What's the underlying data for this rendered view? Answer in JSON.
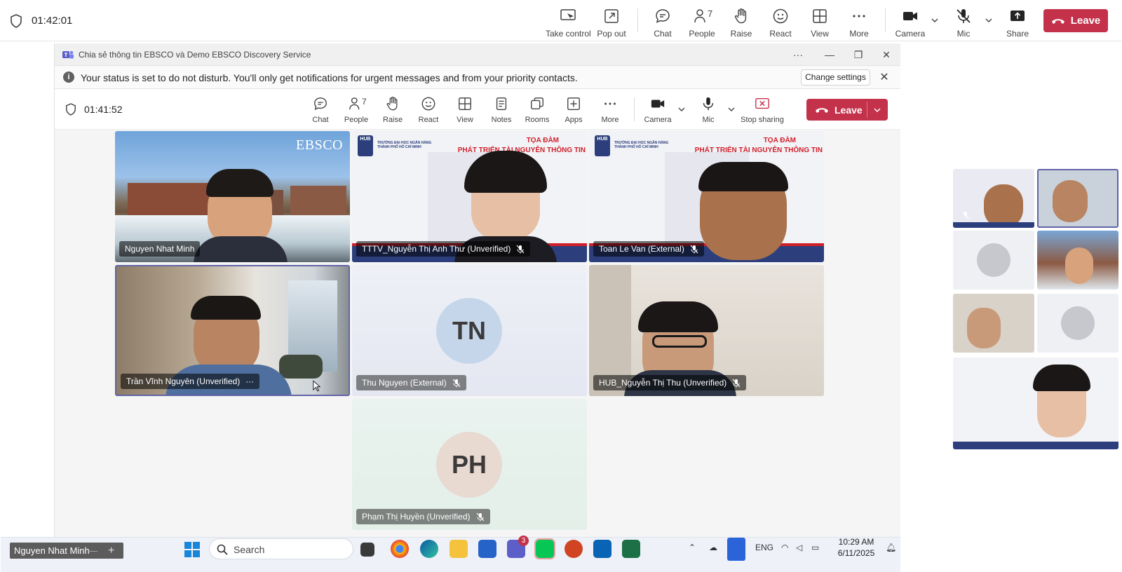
{
  "topbar": {
    "timer": "01:42:01",
    "buttons": {
      "take_control": "Take control",
      "pop_out": "Pop out",
      "chat": "Chat",
      "people": "People",
      "people_count": "7",
      "raise": "Raise",
      "react": "React",
      "view": "View",
      "more": "More",
      "camera": "Camera",
      "mic": "Mic",
      "share": "Share"
    },
    "leave": "Leave"
  },
  "window": {
    "title": "Chia sẻ thông tin EBSCO và Demo EBSCO Discovery Service",
    "banner": "Your status is set to do not disturb. You'll only get notifications for urgent messages and from your priority contacts.",
    "change_settings": "Change settings",
    "toolbar": {
      "timer": "01:41:52",
      "chat": "Chat",
      "people": "People",
      "people_count": "7",
      "raise": "Raise",
      "react": "React",
      "view": "View",
      "notes": "Notes",
      "rooms": "Rooms",
      "apps": "Apps",
      "more": "More",
      "camera": "Camera",
      "mic": "Mic",
      "stop_sharing": "Stop sharing",
      "leave": "Leave"
    }
  },
  "participants": [
    {
      "name": "Nguyen Nhat Minh",
      "logo": "EBSCO"
    },
    {
      "name": "TTTV_Nguyễn Thị Anh Thư (Unverified)"
    },
    {
      "name": "Toan Le Van (External)"
    },
    {
      "name": "Trần Vĩnh Nguyên (Unverified)",
      "more": "···"
    },
    {
      "name": "Thu Nguyen (External)",
      "initials": "TN"
    },
    {
      "name": "HUB_Nguyễn Thị Thu (Unverified)"
    },
    {
      "name": "Phạm Thị Huyền (Unverified)",
      "initials": "PH"
    }
  ],
  "banner_slide": {
    "title1": "TỌA ĐÀM",
    "title2": "PHÁT TRIỂN TÀI NGUYÊN THÔNG TIN",
    "school": "TRƯỜNG ĐẠI HỌC NGÂN HÀNG THÀNH PHỐ HỒ CHÍ MINH",
    "hub": "HUB"
  },
  "taskbar": {
    "user_tag": "Nguyen Nhat Minh",
    "user_tag_dash": "—",
    "user_tag_plus": "+",
    "search_placeholder": "Search",
    "teams_badge": "3",
    "lang": "ENG",
    "time": "10:29 AM",
    "date": "6/11/2025"
  },
  "colors": {
    "accent": "#6264a7",
    "leave": "#c4314b",
    "slide_red": "#d11f2a",
    "slide_navy": "#2c3f7c"
  }
}
